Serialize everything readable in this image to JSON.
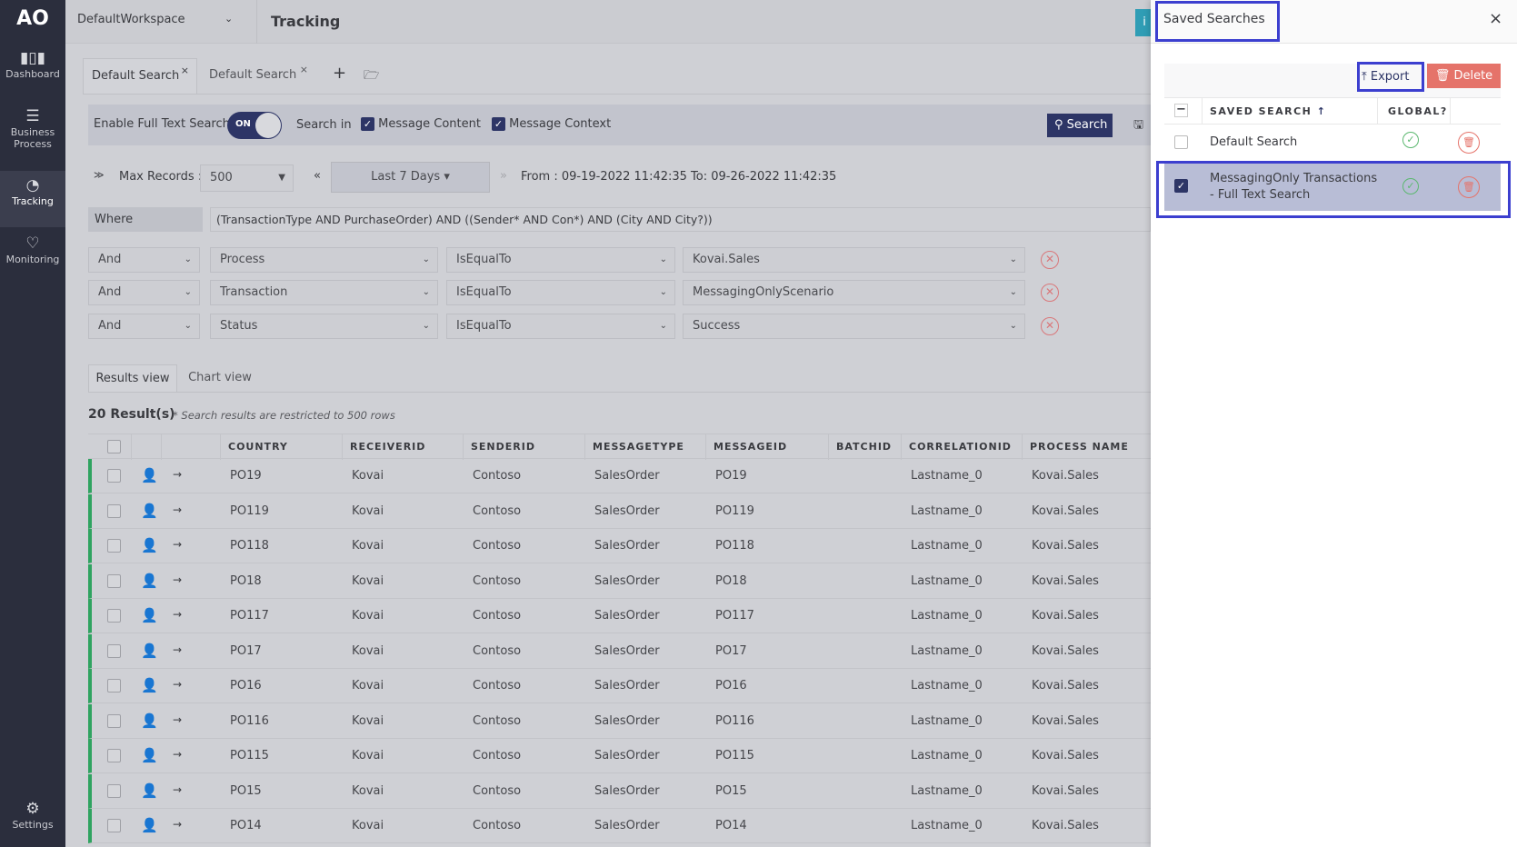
{
  "sidebar": {
    "items": [
      {
        "label": "Dashboard",
        "icon": "bar-chart-icon"
      },
      {
        "label": "Business Process",
        "icon": "list-icon"
      },
      {
        "label": "Tracking",
        "icon": "pie-chart-icon",
        "active": true
      },
      {
        "label": "Monitoring",
        "icon": "heart-pulse-icon"
      }
    ],
    "settings": "Settings"
  },
  "header": {
    "workspace": "DefaultWorkspace",
    "title": "Tracking"
  },
  "tabs": [
    {
      "label": "Default Search"
    },
    {
      "label": "Default Search"
    }
  ],
  "fulltext": {
    "label": "Enable Full Text Search",
    "toggle": "ON",
    "search_in": "Search in",
    "opt1": "Message Content",
    "opt2": "Message Context",
    "search_button": "Search"
  },
  "range": {
    "max_label": "Max Records :",
    "max_value": "500",
    "period": "Last 7 Days",
    "span": "From : 09-19-2022 11:42:35 To: 09-26-2022 11:42:35"
  },
  "where": {
    "label": "Where",
    "expression": "(TransactionType AND PurchaseOrder) AND ((Sender* AND Con*) AND (City AND City?))"
  },
  "filters": [
    {
      "conj": "And",
      "field": "Process",
      "op": "IsEqualTo",
      "value": "Kovai.Sales"
    },
    {
      "conj": "And",
      "field": "Transaction",
      "op": "IsEqualTo",
      "value": "MessagingOnlyScenario"
    },
    {
      "conj": "And",
      "field": "Status",
      "op": "IsEqualTo",
      "value": "Success"
    }
  ],
  "views": {
    "results": "Results view",
    "chart": "Chart view"
  },
  "results": {
    "count": "20 Result(s)",
    "note": "* Search results are restricted to 500 rows",
    "columns": [
      "COUNTRY",
      "RECEIVERID",
      "SENDERID",
      "MESSAGETYPE",
      "MESSAGEID",
      "BATCHID",
      "CORRELATIONID",
      "PROCESS NAME"
    ],
    "rows": [
      [
        "PO19",
        "Kovai",
        "Contoso",
        "SalesOrder",
        "PO19",
        "",
        "Lastname_0",
        "Kovai.Sales"
      ],
      [
        "PO119",
        "Kovai",
        "Contoso",
        "SalesOrder",
        "PO119",
        "",
        "Lastname_0",
        "Kovai.Sales"
      ],
      [
        "PO118",
        "Kovai",
        "Contoso",
        "SalesOrder",
        "PO118",
        "",
        "Lastname_0",
        "Kovai.Sales"
      ],
      [
        "PO18",
        "Kovai",
        "Contoso",
        "SalesOrder",
        "PO18",
        "",
        "Lastname_0",
        "Kovai.Sales"
      ],
      [
        "PO117",
        "Kovai",
        "Contoso",
        "SalesOrder",
        "PO117",
        "",
        "Lastname_0",
        "Kovai.Sales"
      ],
      [
        "PO17",
        "Kovai",
        "Contoso",
        "SalesOrder",
        "PO17",
        "",
        "Lastname_0",
        "Kovai.Sales"
      ],
      [
        "PO16",
        "Kovai",
        "Contoso",
        "SalesOrder",
        "PO16",
        "",
        "Lastname_0",
        "Kovai.Sales"
      ],
      [
        "PO116",
        "Kovai",
        "Contoso",
        "SalesOrder",
        "PO116",
        "",
        "Lastname_0",
        "Kovai.Sales"
      ],
      [
        "PO115",
        "Kovai",
        "Contoso",
        "SalesOrder",
        "PO115",
        "",
        "Lastname_0",
        "Kovai.Sales"
      ],
      [
        "PO15",
        "Kovai",
        "Contoso",
        "SalesOrder",
        "PO15",
        "",
        "Lastname_0",
        "Kovai.Sales"
      ],
      [
        "PO14",
        "Kovai",
        "Contoso",
        "SalesOrder",
        "PO14",
        "",
        "Lastname_0",
        "Kovai.Sales"
      ]
    ]
  },
  "panel": {
    "title": "Saved Searches",
    "export": "Export",
    "delete": "Delete",
    "col_name": "SAVED SEARCH",
    "col_global": "GLOBAL?",
    "items": [
      {
        "name": "Default Search",
        "checked": false
      },
      {
        "name": "MessagingOnly Transactions - Full Text Search",
        "checked": true
      }
    ]
  },
  "colors": {
    "sidebar": "#2b2e3d",
    "accent": "#2d3566",
    "delete": "#e5736a",
    "highlight": "#3c3fcf",
    "success_bar": "#2fa360"
  }
}
